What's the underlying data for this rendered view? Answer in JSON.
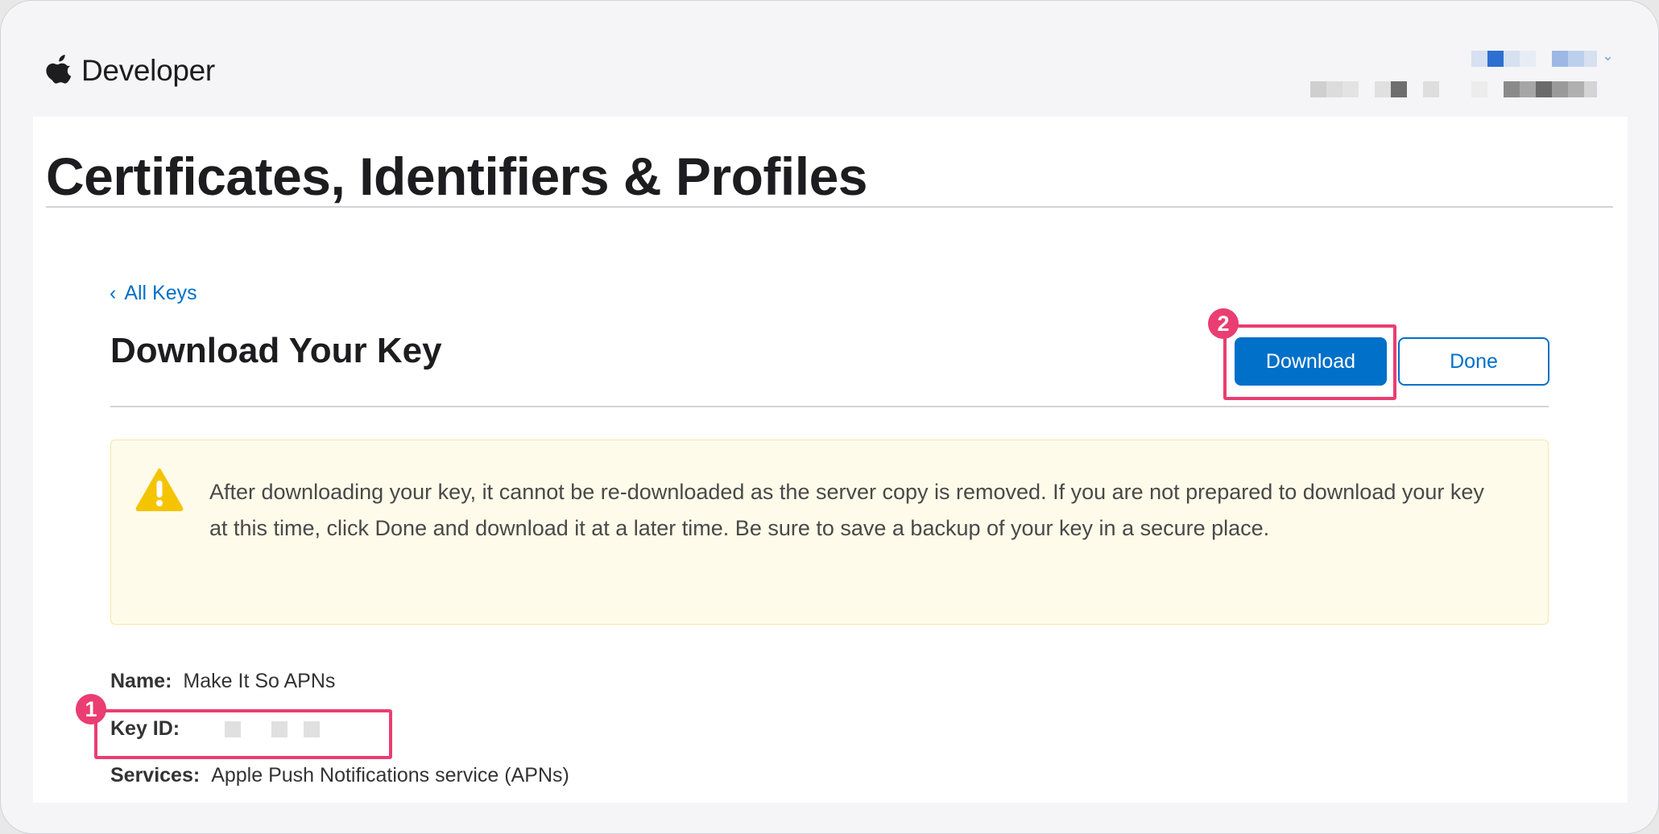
{
  "brand": {
    "name": "Developer"
  },
  "page": {
    "title": "Certificates, Identifiers & Profiles",
    "back_link": "All Keys",
    "heading": "Download Your Key"
  },
  "actions": {
    "download_label": "Download",
    "done_label": "Done"
  },
  "warning": {
    "text": "After downloading your key, it cannot be re-downloaded as the server copy is removed. If you are not prepared to download your key at this time, click Done and download it at a later time. Be sure to save a backup of your key in a secure place."
  },
  "key_info": {
    "name_label": "Name:",
    "name_value": "Make It So APNs",
    "keyid_label": "Key ID:",
    "services_label": "Services:",
    "services_value": "Apple Push Notifications service (APNs)"
  },
  "annotations": {
    "badge_1": "1",
    "badge_2": "2"
  },
  "colors": {
    "accent": "#0070c9",
    "annotation": "#ea3d72",
    "warning_bg": "#fefbea",
    "warning_icon": "#f5c400"
  },
  "icons": {
    "logo": "apple-logo-icon",
    "back": "chevron-left-icon",
    "warning": "warning-triangle-icon"
  }
}
